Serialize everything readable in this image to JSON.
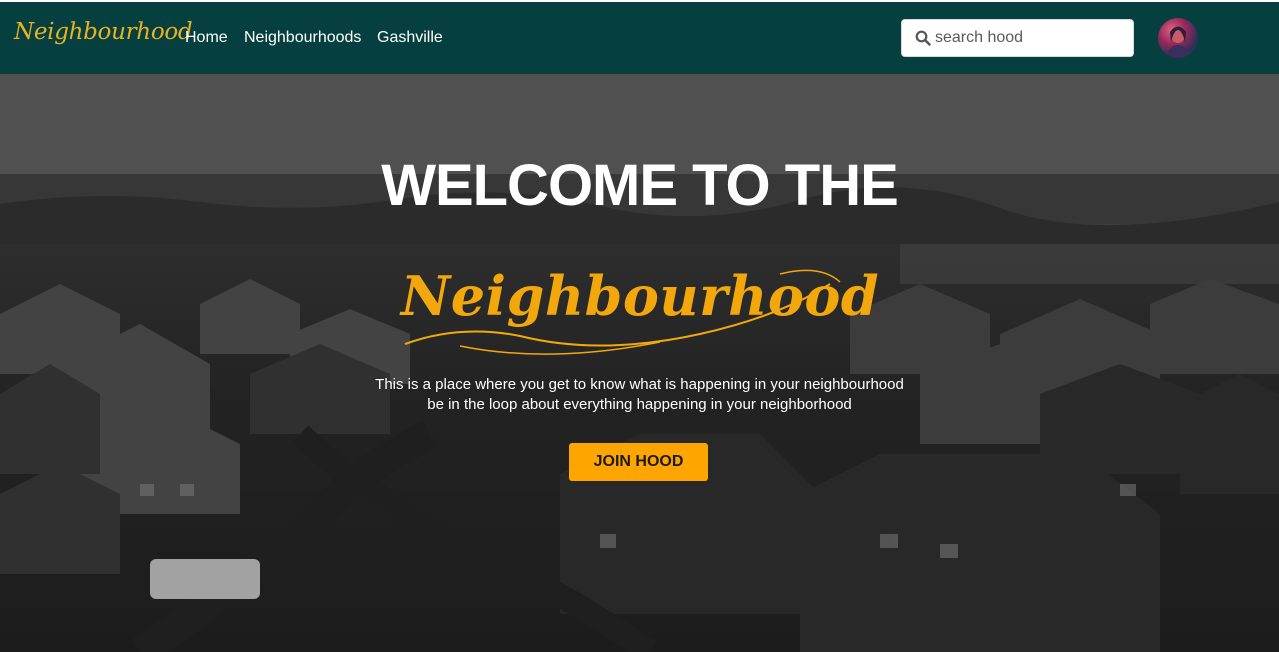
{
  "navbar": {
    "brand": "Neighbourhood",
    "links": [
      "Home",
      "Neighbourhoods",
      "Gashville"
    ],
    "search_placeholder": "search hood",
    "background_color": "#053f3f",
    "brand_color": "#e8b320"
  },
  "hero": {
    "title": "WELCOME TO THE",
    "script_title": "Neighbourhood",
    "description_line1": "This is a place where you get to know what is happening in your neighbourhood",
    "description_line2": "be in the loop about everything happening in your neighborhood",
    "cta_label": "JOIN HOOD",
    "accent_color": "#ffa500"
  },
  "icons": {
    "search": "search-icon",
    "avatar": "user-avatar"
  }
}
